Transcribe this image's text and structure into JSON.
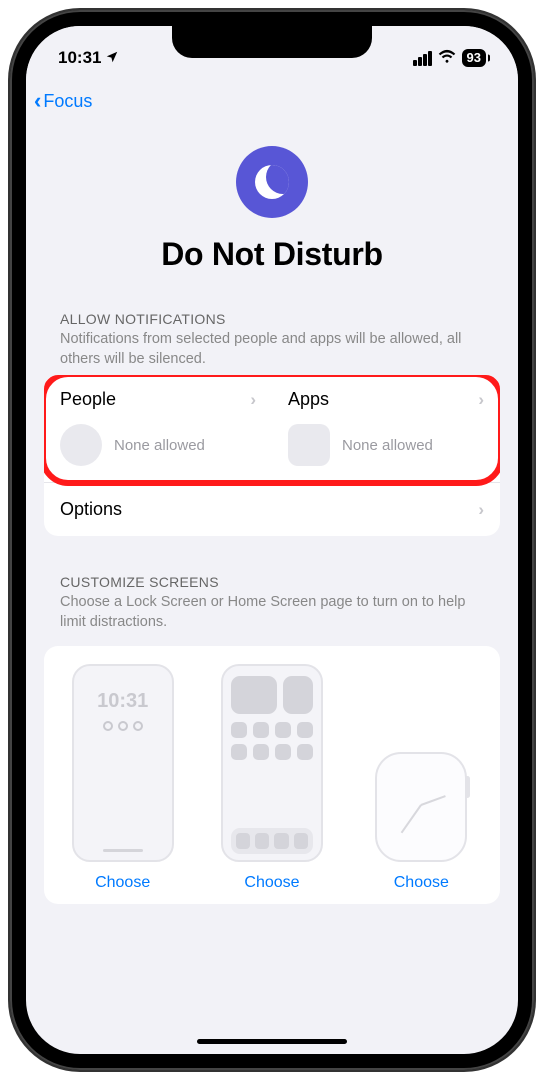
{
  "status": {
    "time": "10:31",
    "battery": "93"
  },
  "nav": {
    "back_label": "Focus"
  },
  "hero": {
    "title": "Do Not Disturb"
  },
  "allow_notifications": {
    "header": "ALLOW NOTIFICATIONS",
    "description": "Notifications from selected people and apps will be allowed, all others will be silenced.",
    "people": {
      "label": "People",
      "status": "None allowed"
    },
    "apps": {
      "label": "Apps",
      "status": "None allowed"
    },
    "options_label": "Options"
  },
  "customize": {
    "header": "CUSTOMIZE SCREENS",
    "description": "Choose a Lock Screen or Home Screen page to turn on to help limit distractions.",
    "lock_time": "10:31",
    "choose_label": "Choose"
  }
}
